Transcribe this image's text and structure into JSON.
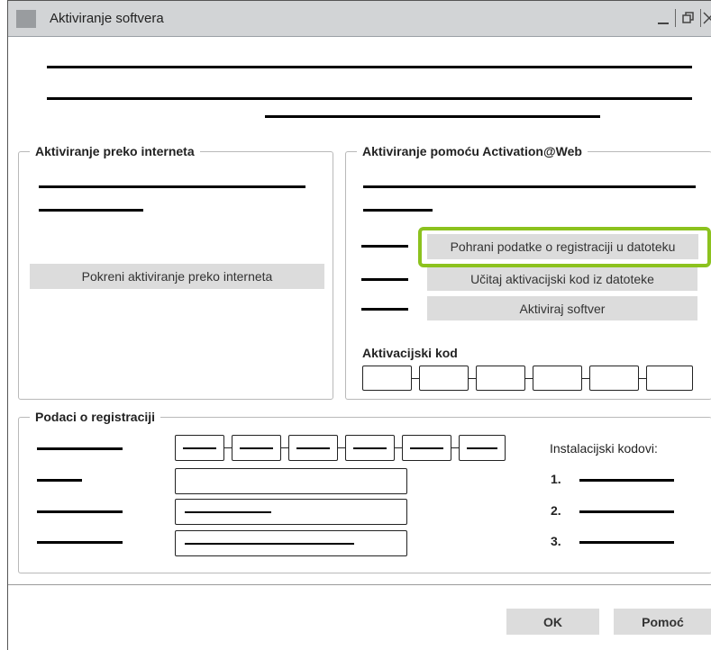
{
  "window": {
    "title": "Aktiviranje softvera",
    "controls": {
      "minimize": "minimize-icon",
      "restore": "restore-icon",
      "close": "close-icon"
    }
  },
  "internet_group": {
    "legend": "Aktiviranje preko interneta",
    "start_button": "Pokreni aktiviranje preko interneta"
  },
  "web_group": {
    "legend": "Aktiviranje pomoću Activation@Web",
    "save_button": "Pohrani podatke o registraciji u datoteku",
    "load_button": "Učitaj aktivacijski kod iz datoteke",
    "activate_button": "Aktiviraj softver",
    "code_label": "Aktivacijski kod"
  },
  "registration_group": {
    "legend": "Podaci o registraciji",
    "install_codes_label": "Instalacijski kodovi:",
    "install_codes": [
      "1.",
      "2.",
      "3."
    ]
  },
  "footer": {
    "ok": "OK",
    "help": "Pomoć"
  },
  "colors": {
    "highlight": "#8cc21e",
    "button_bg": "#dcdcdc",
    "titlebar_bg": "#d2d4d6"
  }
}
